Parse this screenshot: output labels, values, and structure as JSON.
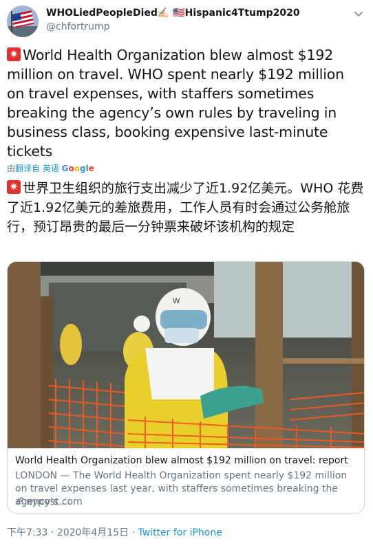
{
  "header": {
    "display_name": "WHOLiedPeopleDied✍🏻 🇺🇸Hispanic4Ttump2020",
    "handle": "@chfortrump"
  },
  "tweet": {
    "english_text": "World Health Organization blew almost $192 million on travel. WHO spent nearly $192 million on travel expenses, with staffers sometimes breaking the agency’s own rules by traveling in business class, booking expensive last-minute tickets",
    "translated_text": "世界卫生组织的旅行支出减少了近1.92亿美元。WHO 花费了近1.92亿美元的差旅费用，工作人员有时会通过公务舱旅行，预订昂贵的最后一分钟票来破坏该机构的规定",
    "siren_glyph": "✷"
  },
  "translation_note": {
    "by": "由",
    "translated_from": "翻译自 英语",
    "google": "Google"
  },
  "card": {
    "title": "World Health Organization blew almost $192 million on travel: report",
    "description": "LONDON — The World Health Organization spent nearly $192 million on travel expenses last year, with staffers sometimes breaking the agency’s ...",
    "domain": "nypost.com",
    "photo_glyph": "W"
  },
  "meta": {
    "time": "下午7:33 · 2020年4月15日 · ",
    "app": "Twitter for iPhone"
  },
  "colors": {
    "link_blue": "#1b95e0",
    "muted": "#657786",
    "siren_red": "#e0312d"
  },
  "icons": [
    "avatar-flag-icon",
    "chevron-down-icon",
    "siren-icon",
    "link-icon"
  ]
}
